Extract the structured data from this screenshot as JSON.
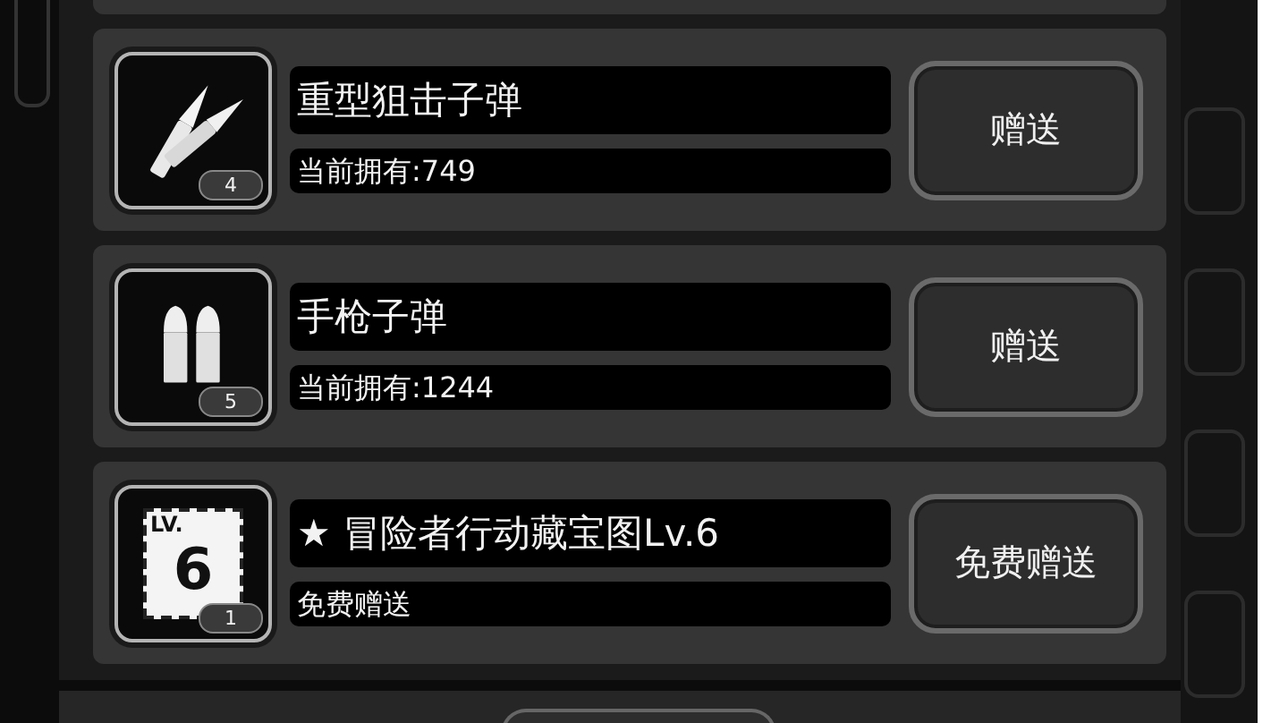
{
  "items": [
    {
      "kind": "rifle",
      "count": "4",
      "name": "重型狙击子弹",
      "detail": "当前拥有:749",
      "button": "赠送"
    },
    {
      "kind": "pistol",
      "count": "5",
      "name": "手枪子弹",
      "detail": "当前拥有:1244",
      "button": "赠送"
    },
    {
      "kind": "map",
      "count": "1",
      "icon_top": "LV.",
      "icon_big": "6",
      "name": "★ 冒险者行动藏宝图Lv.6",
      "detail": "免费赠送",
      "button": "免费赠送"
    }
  ]
}
